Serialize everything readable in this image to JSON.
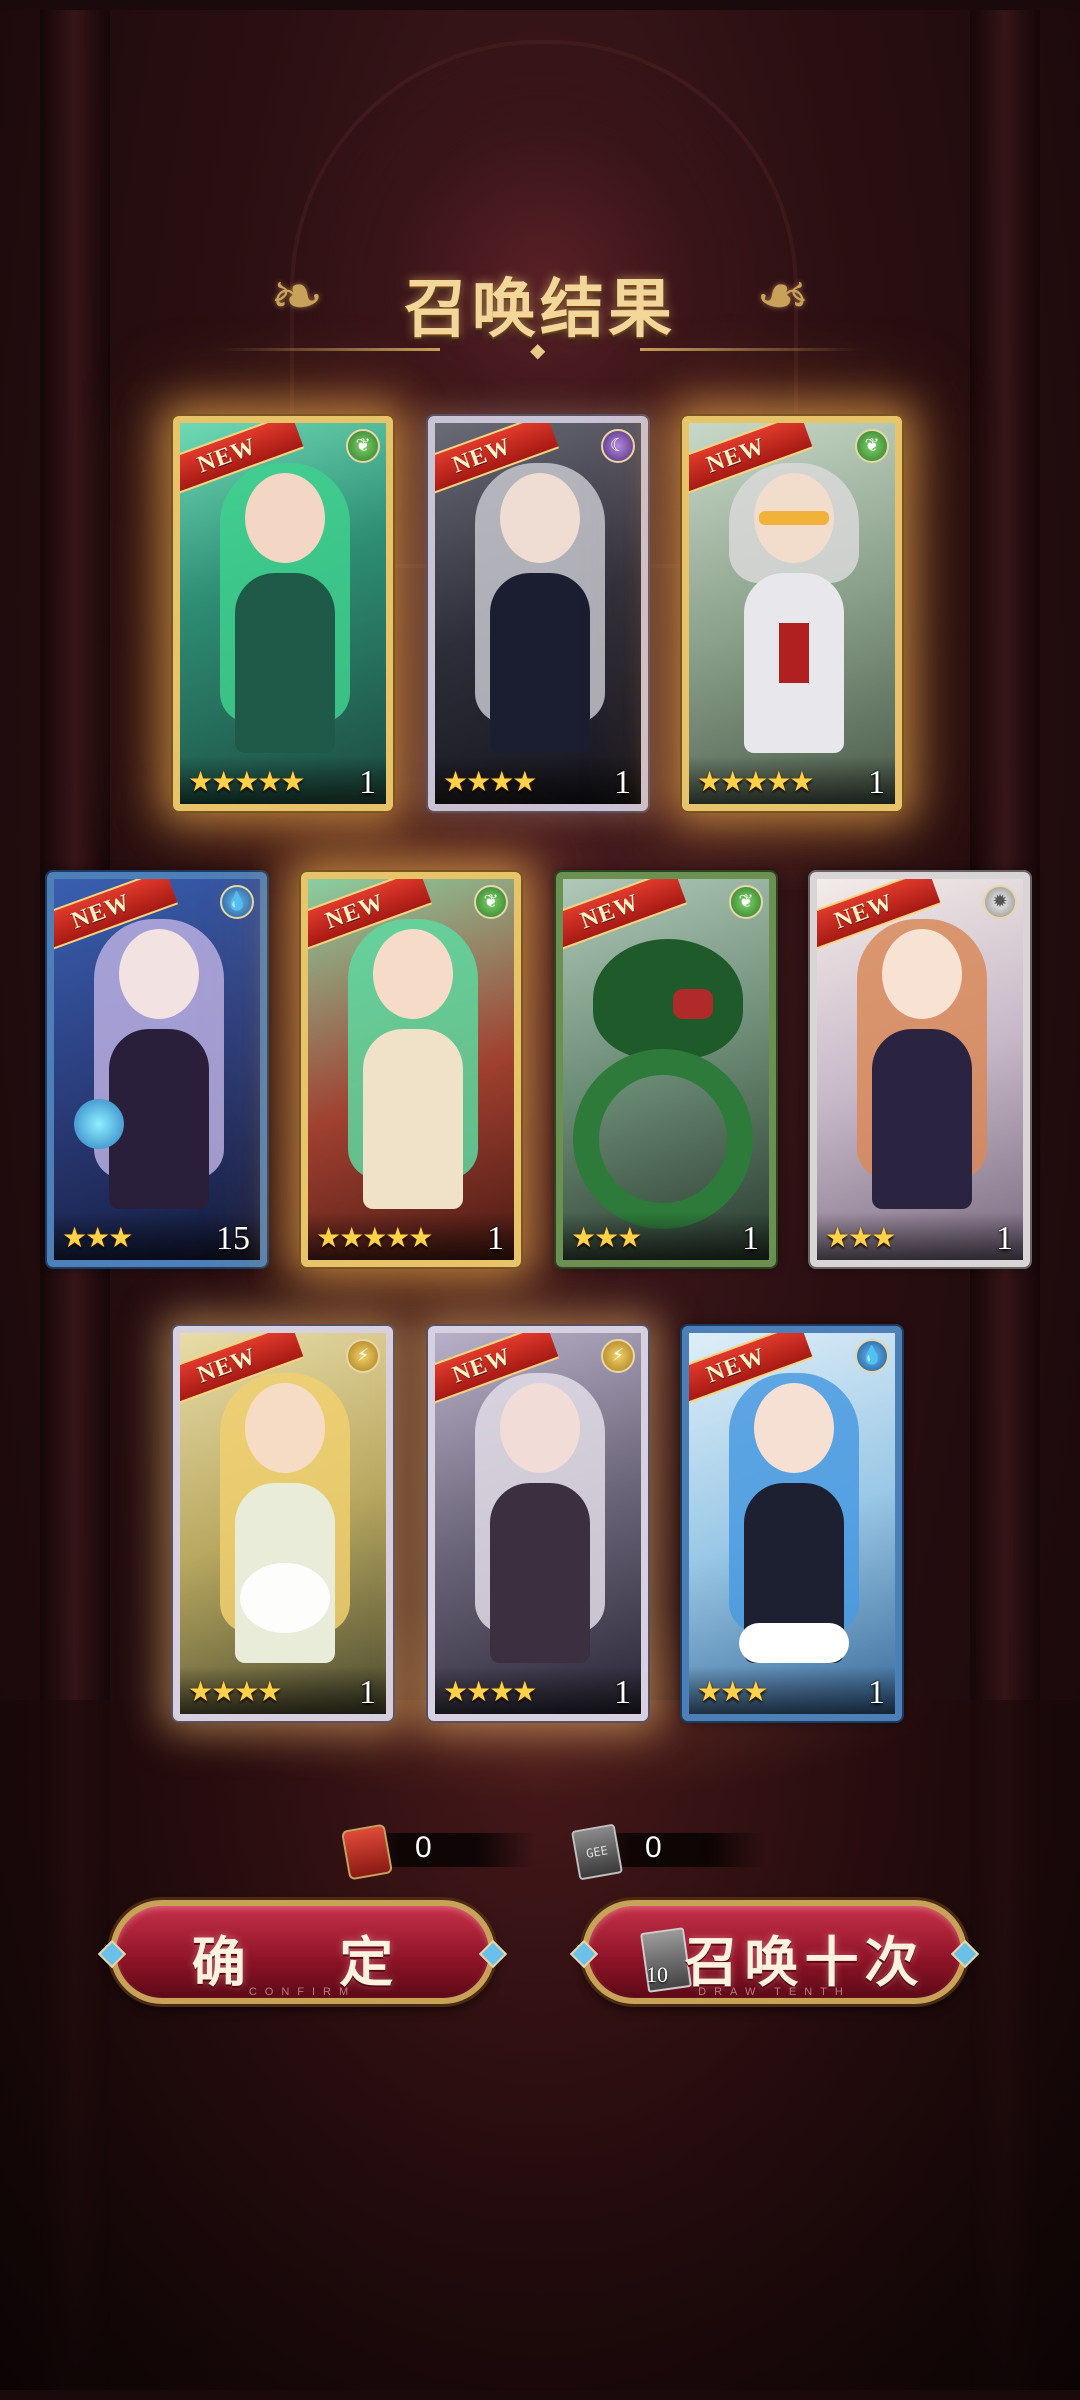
{
  "title": "召唤结果",
  "cards": [
    {
      "new_label": "NEW",
      "stars": "★★★★★",
      "count": "1",
      "element": "wind-icon",
      "element_glyph": "❦"
    },
    {
      "new_label": "NEW",
      "stars": "★★★★",
      "count": "1",
      "element": "dark-icon",
      "element_glyph": "☾"
    },
    {
      "new_label": "NEW",
      "stars": "★★★★★",
      "count": "1",
      "element": "wind-icon",
      "element_glyph": "❦"
    },
    {
      "new_label": "NEW",
      "stars": "★★★",
      "count": "15",
      "element": "water-icon",
      "element_glyph": "💧"
    },
    {
      "new_label": "NEW",
      "stars": "★★★★★",
      "count": "1",
      "element": "wind-icon",
      "element_glyph": "❦"
    },
    {
      "new_label": "NEW",
      "stars": "★★★",
      "count": "1",
      "element": "wind-icon",
      "element_glyph": "❦"
    },
    {
      "new_label": "NEW",
      "stars": "★★★",
      "count": "1",
      "element": "light-icon",
      "element_glyph": "✹"
    },
    {
      "new_label": "NEW",
      "stars": "★★★★",
      "count": "1",
      "element": "thunder-icon",
      "element_glyph": "⚡"
    },
    {
      "new_label": "NEW",
      "stars": "★★★★",
      "count": "1",
      "element": "thunder-icon",
      "element_glyph": "⚡"
    },
    {
      "new_label": "NEW",
      "stars": "★★★",
      "count": "1",
      "element": "water-icon",
      "element_glyph": "💧"
    }
  ],
  "currencies": [
    {
      "icon": "summon-scroll-icon",
      "value": "0"
    },
    {
      "icon": "summon-ticket-icon",
      "ticket_text": "GEE",
      "value": "0"
    }
  ],
  "buttons": {
    "confirm_label": "确 定",
    "confirm_sub": "CONFIRM",
    "draw_label": "召唤十次",
    "draw_sub": "DRAW TENTH",
    "draw_ticket_count": "10"
  },
  "colors": {
    "gold_frame": "#e7c46a",
    "button_red": "#8d1326",
    "star": "#ffd24a",
    "ribbon": "#c8281e"
  }
}
